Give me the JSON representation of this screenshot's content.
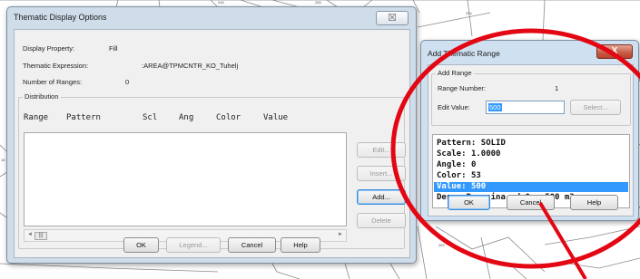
{
  "background": {
    "map_labels": [
      "245",
      "285",
      "294",
      "18",
      "262"
    ]
  },
  "thematic_dialog": {
    "title": "Thematic Display Options",
    "close_glyph": "☒",
    "display_property_label": "Display Property:",
    "display_property_value": "Fill",
    "thematic_expression_label": "Thematic Expression:",
    "thematic_expression_value": ":AREA@TPMCNTR_KO_Tuhelj",
    "number_of_ranges_label": "Number of Ranges:",
    "number_of_ranges_value": "0",
    "distribution_label": "Distribution",
    "columns": [
      "Range",
      "Pattern",
      "Scl",
      "Ang",
      "Color",
      "Value"
    ],
    "rows": [],
    "side_buttons": {
      "edit": "Edit...",
      "insert": "Insert...",
      "add": "Add...",
      "delete": "Delete"
    },
    "scroll_left_glyph": "◄",
    "scroll_right_glyph": "►",
    "scroll_thumb_glyph": "|||",
    "bottom_buttons": {
      "ok": "OK",
      "legend": "Legend...",
      "cancel": "Cancel",
      "help": "Help"
    }
  },
  "range_dialog": {
    "title": "Add Thematic Range",
    "close_glyph": "X",
    "group_label": "Add Range",
    "range_number_label": "Range Number:",
    "range_number_value": "1",
    "edit_value_label": "Edit Value:",
    "edit_value_value": "500",
    "select_button": "Select...",
    "items": [
      {
        "key": "Pattern:",
        "value": "SOLID",
        "selected": false
      },
      {
        "key": "Scale:",
        "value": "1.0000",
        "selected": false
      },
      {
        "key": "Angle:",
        "value": "0",
        "selected": false
      },
      {
        "key": "Color:",
        "value": "53",
        "selected": false
      },
      {
        "key": "Value:",
        "value": "500",
        "selected": true
      },
      {
        "key": "Desc:",
        "value": "Povrsina od 0 - 500 m2",
        "selected": false
      }
    ],
    "ok_button": "OK",
    "cancel_button": "Cancel",
    "help_button": "Help"
  },
  "colors": {
    "dialog_frame": "#cfdce9",
    "client_bg": "#f0f0f0",
    "selection": "#3399ff",
    "annotation_red": "#e30613",
    "close_red": "#c65a42"
  }
}
